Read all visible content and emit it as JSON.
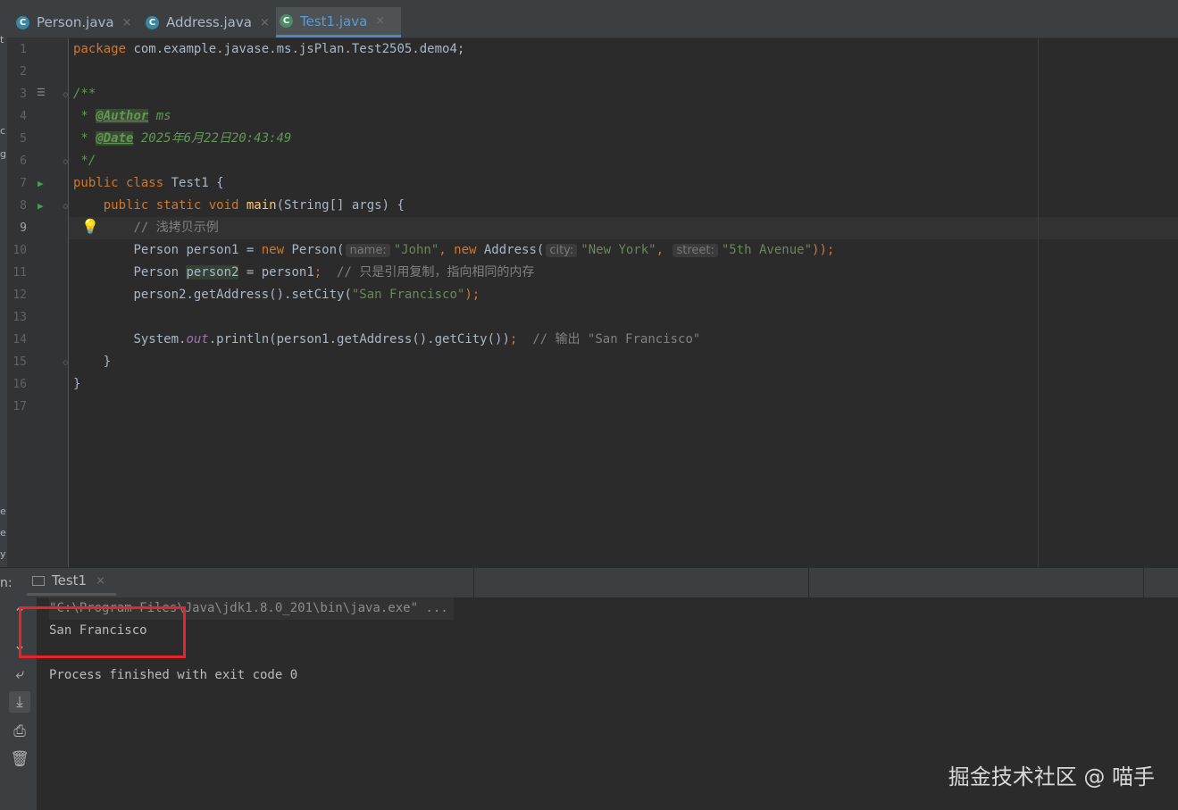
{
  "tabs": [
    {
      "label": "Person.java",
      "icon": "java-class-icon",
      "close": "×"
    },
    {
      "label": "Address.java",
      "icon": "java-class-icon",
      "close": "×"
    },
    {
      "label": "Test1.java",
      "icon": "java-class-modified-icon",
      "close": "×",
      "active": true
    }
  ],
  "editor": {
    "line_numbers": [
      "1",
      "2",
      "3",
      "4",
      "5",
      "6",
      "7",
      "8",
      "9",
      "10",
      "11",
      "12",
      "13",
      "14",
      "15",
      "16",
      "17"
    ],
    "current_line": 9,
    "code": {
      "l1_kw": "package",
      "l1_rest": " com.example.javase.ms.jsPlan.Test2505.demo4;",
      "l3": "/**",
      "l4_star": " * ",
      "l4_tag": "@Author",
      "l4_val": " ms",
      "l5_star": " * ",
      "l5_tag": "@Date",
      "l5_val": " 2025年6月22日20:43:49",
      "l6": " */",
      "l7_kw": "public class",
      "l7_rest": " Test1 {",
      "l8_indent": "    ",
      "l8_kw": "public static void",
      "l8_fn": " main",
      "l8_rest": "(String[] args) {",
      "l9_indent": "        ",
      "l9_cmt": "// 浅拷贝示例",
      "l10_indent": "        ",
      "l10_a": "Person person1 = ",
      "l10_new1": "new",
      "l10_b": " Person(",
      "l10_hint1": "name:",
      "l10_s1": "\"John\"",
      "l10_comma": ", ",
      "l10_new2": "new",
      "l10_c": " Address(",
      "l10_hint2": "city:",
      "l10_s2": "\"New York\"",
      "l10_comma2": ", ",
      "l10_hint3": "street:",
      "l10_s3": "\"5th Avenue\"",
      "l10_end": "));",
      "l11_indent": "        ",
      "l11_a": "Person ",
      "l11_var": "person2",
      "l11_b": " = person1",
      "l11_semi": ";",
      "l11_cmt": "  // 只是引用复制，指向相同的内存",
      "l12_indent": "        ",
      "l12_a": "person2.getAddress().setCity(",
      "l12_s": "\"San Francisco\"",
      "l12_end": ");",
      "l14_indent": "        ",
      "l14_a": "System.",
      "l14_field": "out",
      "l14_b": ".println(person1.getAddress().getCity())",
      "l14_semi": ";",
      "l14_cmt": "  // 输出 \"San Francisco\"",
      "l15": "    }",
      "l16": "}"
    }
  },
  "run": {
    "panel_label": "n:",
    "tab_label": "Test1",
    "tab_close": "×",
    "console": {
      "command": "\"C:\\Program Files\\Java\\jdk1.8.0_201\\bin\\java.exe\" ...",
      "output": "San Francisco",
      "exit": "Process finished with exit code 0"
    }
  },
  "left_strip_chars": [
    "t",
    "c",
    "g",
    "e",
    "e",
    "y"
  ],
  "watermark": "掘金技术社区 @ 喵手",
  "colors": {
    "background": "#2b2b2b",
    "keyword": "#cc7832",
    "string": "#6a8759",
    "comment": "#808080",
    "accent": "#4a88c7",
    "highlight_box": "#e8242a"
  }
}
